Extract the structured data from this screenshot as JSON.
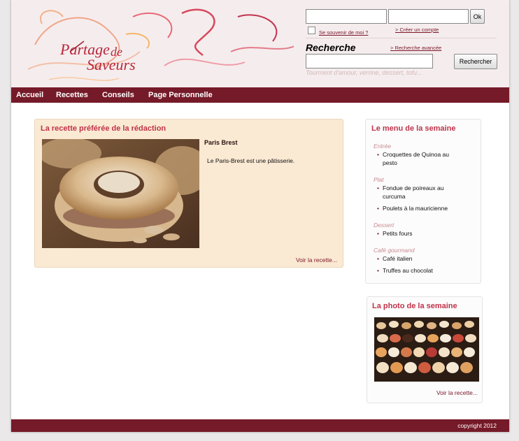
{
  "header": {
    "logo_words": [
      "Partage",
      "de",
      "Saveurs"
    ],
    "login": {
      "ok_label": "Ok",
      "remember_label": "Se souvenir de moi ?",
      "create_account_label": "> Créer un compte"
    },
    "search": {
      "title": "Recherche",
      "advanced_label": "> Recherche avancée",
      "button_label": "Rechercher",
      "hint": "Tourment d'amour, verrine, dessert, tofu..."
    }
  },
  "nav": {
    "items": [
      "Accueil",
      "Recettes",
      "Conseils",
      "Page Personnelle"
    ]
  },
  "featured": {
    "title": "La recette préférée de la rédaction",
    "recipe_name": "Paris Brest",
    "description": "Le Paris-Brest est une pâtisserie.",
    "more_label": "Voir la recette..."
  },
  "menu_week": {
    "title": "Le menu de la semaine",
    "categories": [
      {
        "name": "Entrée",
        "items": [
          "Croquettes de Quinoa au",
          "pesto"
        ]
      },
      {
        "name": "Plat",
        "items": [
          "Fondue de poireaux au",
          "curcuma",
          "Poulets à la mauricienne"
        ]
      },
      {
        "name": "Dessert",
        "items": [
          "Petits fours"
        ]
      },
      {
        "name": "Café gourmand",
        "items": [
          "Café italien",
          "Truffes au chocolat"
        ]
      }
    ]
  },
  "photo_week": {
    "title": "La photo de la semaine",
    "more_label": "Voir la recette..."
  },
  "footer": {
    "copyright": "copyright 2012"
  },
  "colors": {
    "brand": "#751a28",
    "title_red": "#c0334a",
    "featured_bg": "#fae9d3"
  }
}
